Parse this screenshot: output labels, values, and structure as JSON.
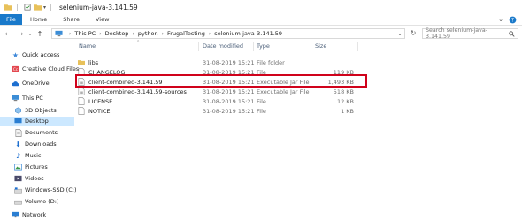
{
  "window": {
    "title": "selenium-java-3.141.59"
  },
  "ribbon": {
    "tabs": [
      "File",
      "Home",
      "Share",
      "View"
    ]
  },
  "address": {
    "crumbs": [
      "This PC",
      "Desktop",
      "python",
      "FrugalTesting",
      "selenium-java-3.141.59"
    ],
    "search_placeholder": "Search selenium-java-3.141.59"
  },
  "nav": {
    "quick_access": "Quick access",
    "creative_cloud": "Creative Cloud Files",
    "onedrive": "OneDrive",
    "this_pc": "This PC",
    "objects_3d": "3D Objects",
    "desktop": "Desktop",
    "documents": "Documents",
    "downloads": "Downloads",
    "music": "Music",
    "pictures": "Pictures",
    "videos": "Videos",
    "windows_ssd": "Windows-SSD (C:)",
    "volume_d": "Volume (D:)",
    "network": "Network"
  },
  "columns": {
    "name": "Name",
    "date": "Date modified",
    "type": "Type",
    "size": "Size"
  },
  "files": [
    {
      "name": "libs",
      "date": "31-08-2019 15:21",
      "type": "File folder",
      "size": ""
    },
    {
      "name": "CHANGELOG",
      "date": "31-08-2019 15:21",
      "type": "File",
      "size": "119 KB"
    },
    {
      "name": "client-combined-3.141.59",
      "date": "31-08-2019 15:21",
      "type": "Executable Jar File",
      "size": "1,493 KB"
    },
    {
      "name": "client-combined-3.141.59-sources",
      "date": "31-08-2019 15:21",
      "type": "Executable Jar File",
      "size": "518 KB"
    },
    {
      "name": "LICENSE",
      "date": "31-08-2019 15:21",
      "type": "File",
      "size": "12 KB"
    },
    {
      "name": "NOTICE",
      "date": "31-08-2019 15:21",
      "type": "File",
      "size": "1 KB"
    }
  ],
  "colors": {
    "accent": "#1979ca",
    "folder": "#e8c15a",
    "selection": "#cce8ff",
    "highlight_box": "#d0021b"
  }
}
